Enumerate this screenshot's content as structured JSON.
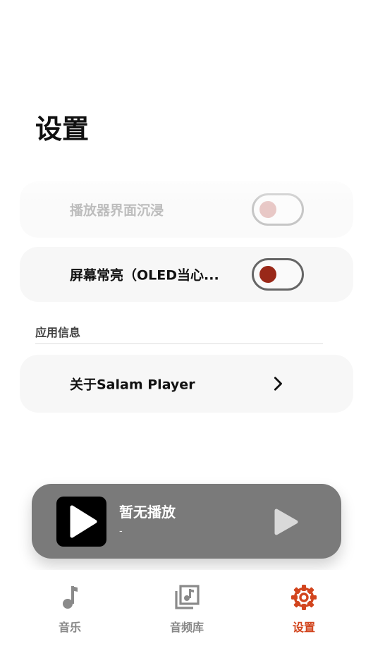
{
  "page": {
    "title": "设置"
  },
  "settings": {
    "immersive_label": "播放器界面沉浸",
    "immersive_on": false,
    "keep_screen_on_label": "屏幕常亮（OLED当心...",
    "keep_screen_on": true,
    "toggle_accent": "#992818"
  },
  "section": {
    "app_info": "应用信息"
  },
  "about": {
    "label": "关于Salam Player"
  },
  "player": {
    "title": "暂无播放",
    "subtitle": "-",
    "play_icon": "play-icon"
  },
  "nav": {
    "active_color": "#d2451e",
    "items": [
      {
        "label": "音乐",
        "icon": "music-note-icon"
      },
      {
        "label": "音频库",
        "icon": "music-library-icon"
      },
      {
        "label": "设置",
        "icon": "gear-icon"
      }
    ]
  }
}
